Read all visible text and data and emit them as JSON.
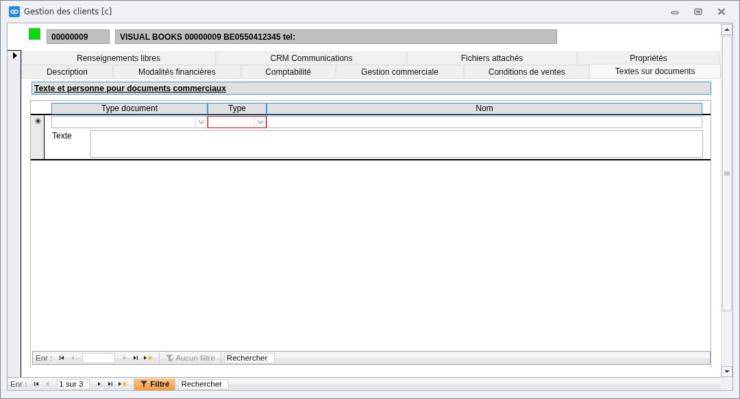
{
  "window": {
    "title": "Gestion des clients [c]"
  },
  "header": {
    "code": "00000009",
    "name": "VISUAL BOOKS 00000009 BE0550412345 tel:"
  },
  "tab_rows": [
    [
      {
        "label": "Renseignements libres",
        "selected": false
      },
      {
        "label": "CRM Communications",
        "selected": false
      },
      {
        "label": "Fichiers attachés",
        "selected": false
      },
      {
        "label": "Propriétés",
        "selected": false
      }
    ],
    [
      {
        "label": "Description",
        "selected": false
      },
      {
        "label": "Modalités financières",
        "selected": false
      },
      {
        "label": "Comptabilité",
        "selected": false
      },
      {
        "label": "Gestion commerciale",
        "selected": false
      },
      {
        "label": "Conditions de ventes",
        "selected": false
      },
      {
        "label": "Textes sur documents",
        "selected": true
      }
    ]
  ],
  "section": {
    "title": "Texte et personne pour documents commerciaux"
  },
  "subform": {
    "columns": [
      "Type document",
      "Type",
      "Nom"
    ],
    "type_invalid": true,
    "text_label": "Texte",
    "navigator": {
      "label": "Enr :",
      "can_prev": false,
      "can_next": false,
      "filter": "Aucun filtre",
      "filter_active": false,
      "placeholder": "Rechercher"
    }
  },
  "navigator": {
    "label": "Enr :",
    "position": "1 sur 3",
    "can_prev": false,
    "can_next": true,
    "filter": "Filtré",
    "filter_active": true,
    "placeholder": "Rechercher"
  }
}
